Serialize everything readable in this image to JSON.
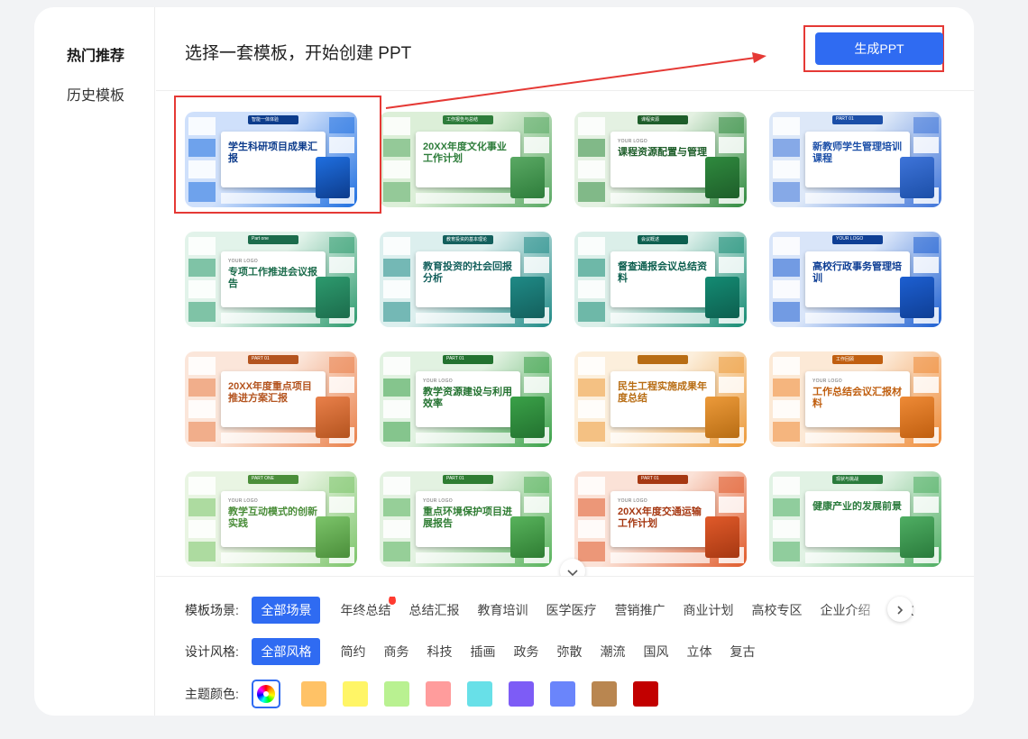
{
  "sidebar": {
    "items": [
      {
        "label": "热门推荐",
        "active": true
      },
      {
        "label": "历史模板",
        "active": false
      }
    ]
  },
  "header": {
    "title": "选择一套模板，开始创建 PPT",
    "generate_label": "生成PPT"
  },
  "templates": [
    {
      "title": "学生科研项目成果汇报",
      "tab": "智能一体体验",
      "logo": "",
      "colors": [
        "#1f6fe0",
        "#cfe0fb",
        "#0d3c8c"
      ]
    },
    {
      "title": "20XX年度文化事业工作计划",
      "tab": "工作报告与总结",
      "logo": "",
      "colors": [
        "#5aa964",
        "#dcefd8",
        "#2e7d3b"
      ]
    },
    {
      "title": "课程资源配置与管理",
      "tab": "课程资源",
      "logo": "YOUR LOGO",
      "colors": [
        "#2f8a3e",
        "#e4f1e2",
        "#1e5e2a"
      ]
    },
    {
      "title": "新教师学生管理培训课程",
      "tab": "PART 01",
      "logo": "",
      "colors": [
        "#3e74d9",
        "#dde8f8",
        "#1c4fa8"
      ]
    },
    {
      "title": "专项工作推进会议报告",
      "tab": "Part one",
      "logo": "YOUR LOGO",
      "colors": [
        "#2d9a6e",
        "#e2f3ea",
        "#1c6c4c"
      ]
    },
    {
      "title": "教育投资的社会回报分析",
      "tab": "教育投资的基本理论",
      "logo": "",
      "colors": [
        "#1f8a86",
        "#dcefee",
        "#14605d"
      ]
    },
    {
      "title": "督查通报会议总结资料",
      "tab": "会议概述",
      "logo": "",
      "colors": [
        "#148b73",
        "#dbefe9",
        "#0d5f4f"
      ]
    },
    {
      "title": "高校行政事务管理培训",
      "tab": "YOUR LOGO",
      "logo": "",
      "colors": [
        "#1d5fd1",
        "#d9e5f9",
        "#0f3f95"
      ]
    },
    {
      "title": "20XX年度重点项目推进方案汇报",
      "tab": "PART 01",
      "logo": "",
      "colors": [
        "#e9804a",
        "#fbe6da",
        "#b4541f"
      ]
    },
    {
      "title": "教学资源建设与利用效率",
      "tab": "PART 01",
      "logo": "YOUR LOGO",
      "colors": [
        "#3aa148",
        "#e1f2e1",
        "#237230"
      ]
    },
    {
      "title": "民生工程实施成果年度总结",
      "tab": "",
      "logo": "",
      "colors": [
        "#ec9a3a",
        "#fcefdc",
        "#b86d14"
      ]
    },
    {
      "title": "工作总结会议汇报材料",
      "tab": "工作回顾",
      "logo": "YOUR LOGO",
      "colors": [
        "#ee8a36",
        "#fce9d6",
        "#c05f10"
      ]
    },
    {
      "title": "教学互动模式的创新实践",
      "tab": "PART ONE",
      "logo": "YOUR LOGO",
      "colors": [
        "#7cc46a",
        "#e9f5e3",
        "#4b8e3a"
      ]
    },
    {
      "title": "重点环境保护项目进展报告",
      "tab": "PART 01",
      "logo": "YOUR LOGO",
      "colors": [
        "#58b35c",
        "#e3f2e1",
        "#2f7d33"
      ]
    },
    {
      "title": "20XX年度交通运输工作计划",
      "tab": "PART 01",
      "logo": "YOUR LOGO",
      "colors": [
        "#e05a2a",
        "#fbe2d7",
        "#a63812"
      ]
    },
    {
      "title": "健康产业的发展前景",
      "tab": "现状与挑战",
      "logo": "",
      "colors": [
        "#4fae63",
        "#e1f2e4",
        "#2a7b3c"
      ]
    }
  ],
  "filters": {
    "scene": {
      "label": "模板场景:",
      "options": [
        "全部场景",
        "年终总结",
        "总结汇报",
        "教育培训",
        "医学医疗",
        "营销推广",
        "商业计划",
        "高校专区",
        "企业介绍",
        "党政"
      ]
    },
    "style": {
      "label": "设计风格:",
      "options": [
        "全部风格",
        "简约",
        "商务",
        "科技",
        "插画",
        "政务",
        "弥散",
        "潮流",
        "国风",
        "立体",
        "复古"
      ]
    },
    "color": {
      "label": "主题颜色:",
      "swatches": [
        "#ffc266",
        "#fff566",
        "#b9f191",
        "#ff9c9c",
        "#68e0e8",
        "#7d5cf6",
        "#6a85fb",
        "#b98650",
        "#c20000"
      ]
    }
  }
}
